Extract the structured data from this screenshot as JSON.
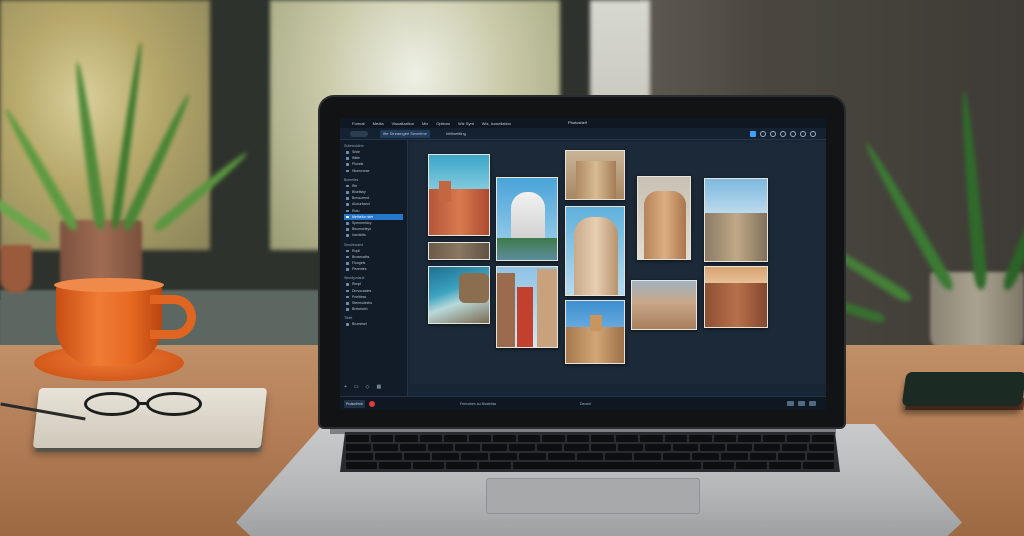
{
  "app": {
    "title": "Photoshelf",
    "menu": [
      "Format",
      "Media",
      "Visualization",
      "Mix",
      "Options",
      "Wiz Synt",
      "Wiz, Iconellation"
    ],
    "toolbar_tabs": [
      "Iffe Streamgerl Sevetime",
      "Ielitisettling"
    ],
    "sidebar": {
      "sections": [
        {
          "head": "Sidlereddirm",
          "items": [
            "Srkie",
            "Ifikile",
            "Pluxals",
            "Hicenvorse"
          ]
        },
        {
          "head": "Bomelles",
          "items": [
            "Rie",
            "Bisellsby",
            "Breouzend",
            "Alcsurband",
            "Rotu",
            "Metheloo ster",
            "Spenmeldoy",
            "Bisumorleys",
            "Iosmlolts"
          ]
        },
        {
          "head": "Smolleculed",
          "items": [
            "Ropli",
            "Brosecalbs",
            "Floogels",
            "Pisrentes"
          ]
        },
        {
          "head": "Wnedyvdarct",
          "items": [
            "Renpl",
            "Dmvocastes",
            "Pneitiess",
            "Stemsoleshs",
            "Brekelcbh"
          ]
        },
        {
          "head": "Tibiel",
          "items": [
            "Brumrisel"
          ]
        }
      ],
      "selected": "Metheloo ster"
    },
    "status": {
      "badge": "Protunlimb",
      "center": "Frirnorkes au Bicstefaa",
      "right": "Deowit"
    }
  }
}
